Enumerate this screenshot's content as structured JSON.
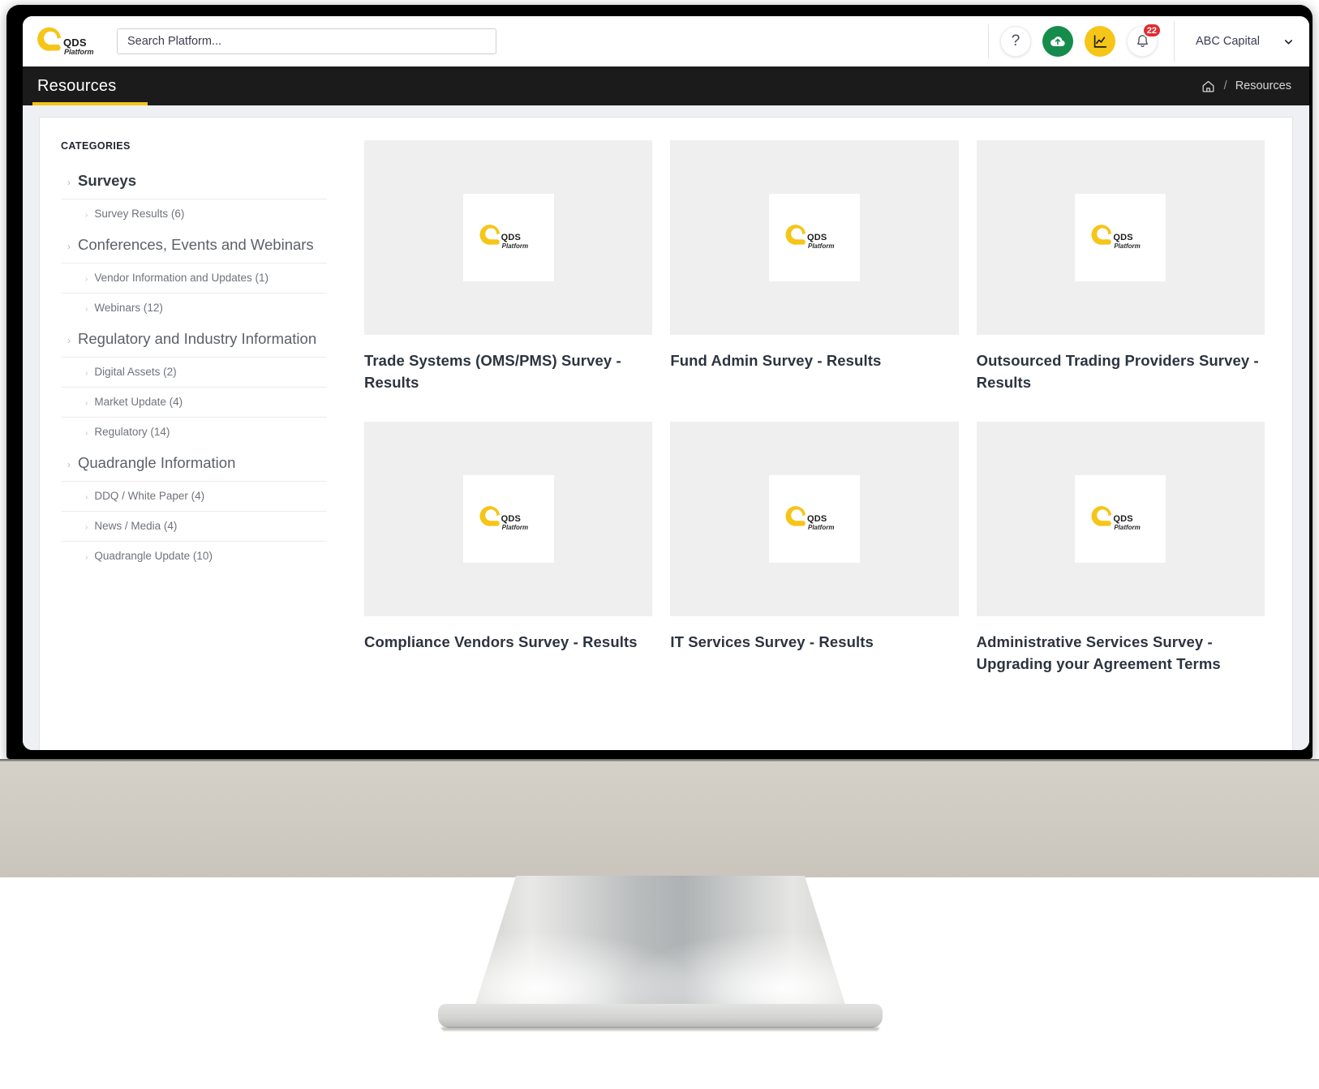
{
  "brand": {
    "name": "QDS",
    "tagline": "Platform",
    "accent_yellow": "#f5c518",
    "nav_black": "#1b1b1b",
    "upload_green": "#158c4c",
    "badge_red": "#e02b32"
  },
  "topbar": {
    "search": {
      "placeholder": "Search Platform...",
      "value": ""
    },
    "icons": {
      "help": "?",
      "upload": "cloud-upload-icon",
      "chart": "chart-icon",
      "bell": "bell-icon"
    },
    "notification_count": "22",
    "account": {
      "name": "ABC Capital",
      "caret": "chevron-down-icon"
    }
  },
  "navbar": {
    "title": "Resources",
    "breadcrumb": {
      "home_icon": "home-icon",
      "separator": "/",
      "current": "Resources"
    }
  },
  "sidebar": {
    "heading": "CATEGORIES",
    "groups": [
      {
        "label": "Surveys",
        "active": true,
        "items": [
          {
            "label": "Survey Results (6)"
          }
        ]
      },
      {
        "label": "Conferences, Events and Webinars",
        "active": false,
        "items": [
          {
            "label": "Vendor Information and Updates (1)"
          },
          {
            "label": "Webinars (12)"
          }
        ]
      },
      {
        "label": "Regulatory and Industry Information",
        "active": false,
        "items": [
          {
            "label": "Digital Assets (2)"
          },
          {
            "label": "Market Update (4)"
          },
          {
            "label": "Regulatory (14)"
          }
        ]
      },
      {
        "label": "Quadrangle Information",
        "active": false,
        "items": [
          {
            "label": "DDQ / White Paper (4)"
          },
          {
            "label": "News / Media (4)"
          },
          {
            "label": "Quadrangle Update (10)"
          }
        ]
      }
    ]
  },
  "cards": [
    {
      "title": "Trade Systems (OMS/PMS) Survey - Results",
      "thumb_icon": "qds-logo-icon"
    },
    {
      "title": "Fund Admin Survey - Results",
      "thumb_icon": "qds-logo-icon"
    },
    {
      "title": "Outsourced Trading Providers Survey - Results",
      "thumb_icon": "qds-logo-icon"
    },
    {
      "title": "Compliance Vendors Survey - Results",
      "thumb_icon": "qds-logo-icon"
    },
    {
      "title": "IT Services Survey - Results",
      "thumb_icon": "qds-logo-icon"
    },
    {
      "title": "Administrative Services Survey - Upgrading your Agreement Terms",
      "thumb_icon": "qds-logo-icon"
    }
  ]
}
